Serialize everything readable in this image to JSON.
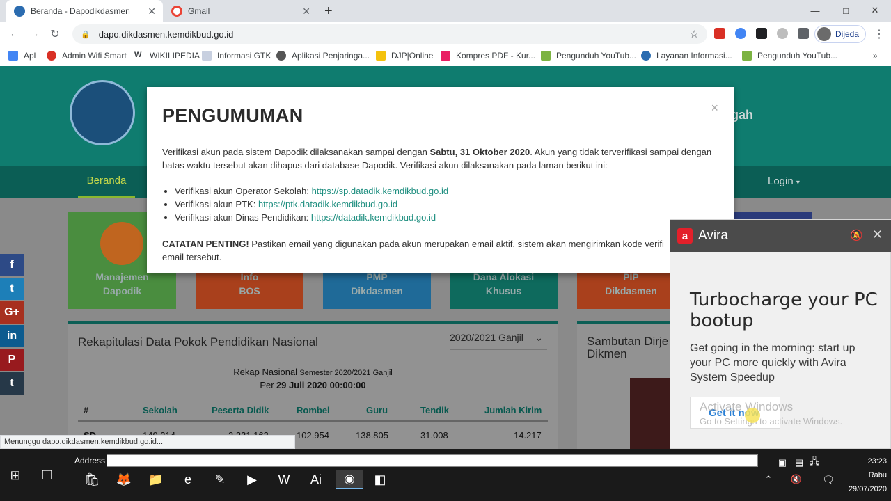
{
  "browser": {
    "tabs": [
      {
        "title": "Beranda - Dapodikdasmen",
        "active": true
      },
      {
        "title": "Gmail",
        "active": false
      }
    ],
    "new_tab_label": "+",
    "window_controls": {
      "minimize": "—",
      "maximize": "□",
      "close": "✕"
    },
    "url": "dapo.dikdasmen.kemdikbud.go.id",
    "profile_name": "Dijeda",
    "bookmarks": [
      "Apl",
      "Admin Wifi Smart",
      "WIKILIPEDIA",
      "Informasi GTK",
      "Aplikasi Penjaringa...",
      "DJP|Online",
      "Kompres PDF - Kur...",
      "Pengunduh YouTub...",
      "Layanan Informasi...",
      "Pengunduh YouTub..."
    ],
    "status_text": "Menunggu dapo.dikdasmen.kemdikbud.go.id..."
  },
  "site": {
    "header_right_text": "gah",
    "nav_active": "Beranda",
    "nav_login": "Login",
    "tiles": [
      {
        "label1": "Manajemen",
        "label2": "Dapodik",
        "color": "#4a8d3f"
      },
      {
        "label1": "Info",
        "label2": "BOS",
        "color": "#a9401c"
      },
      {
        "label1": "PMP",
        "label2": "Dikdasmen",
        "color": "#1f6a98"
      },
      {
        "label1": "Dana Alokasi",
        "label2": "Khusus",
        "color": "#0e6a5d"
      },
      {
        "label1": "PIP",
        "label2": "Dikdasmen",
        "color": "#a9401c"
      }
    ],
    "socials": [
      "f",
      "t",
      "G+",
      "in",
      "P",
      "t"
    ],
    "rekap": {
      "title": "Rekapitulasi Data Pokok Pendidikan Nasional",
      "semester_select": "2020/2021 Ganjil",
      "line1_a": "Rekap Nasional",
      "line1_b": "Semester 2020/2021 Ganjil",
      "line2_a": "Per",
      "line2_b": "29 Juli 2020 00:00:00",
      "headers": [
        "#",
        "Sekolah",
        "Peserta Didik",
        "Rombel",
        "Guru",
        "Tendik",
        "Jumlah Kirim"
      ],
      "row": [
        "SD",
        "149.214",
        "2.231.163",
        "102.954",
        "138.805",
        "31.008",
        "14.217"
      ]
    },
    "sambutan_title": "Sambutan Dirje Dikmen"
  },
  "modal": {
    "title": "PENGUMUMAN",
    "close": "×",
    "p1_a": "Verifikasi akun pada sistem Dapodik dilaksanakan sampai dengan ",
    "p1_b": "Sabtu, 31 Oktober 2020",
    "p1_c": ". Akun yang tidak terverifikasi sampai dengan batas waktu tersebut akan dihapus dari database Dapodik. Verifikasi akun dilaksanakan pada laman berikut ini:",
    "items": [
      {
        "label": "Verifikasi akun Operator Sekolah: ",
        "link": "https://sp.datadik.kemdikbud.go.id"
      },
      {
        "label": "Verifikasi akun PTK: ",
        "link": "https://ptk.datadik.kemdikbud.go.id"
      },
      {
        "label": "Verifikasi akun Dinas Pendidikan: ",
        "link": "https://datadik.kemdikbud.go.id"
      }
    ],
    "note_bold": "CATATAN PENTING!",
    "note_text": " Pastikan email yang digunakan pada akun merupakan email aktif, sistem akan mengirimkan kode verifi email tersebut."
  },
  "avira": {
    "brand": "Avira",
    "headline": "Turbocharge your PC bootup",
    "description": "Get going in the morning: start up your PC more quickly with Avira System Speedup",
    "cta": "Get it now"
  },
  "watermark": {
    "line1": "Activate Windows",
    "line2": "Go to Settings to activate Windows."
  },
  "taskbar": {
    "address_label": "Address",
    "time": "23:23",
    "day": "Rabu",
    "date": "29/07/2020"
  },
  "colors": {
    "teal": "#0f7c6f",
    "link": "#1f8f80",
    "avira_red": "#e3202a"
  }
}
